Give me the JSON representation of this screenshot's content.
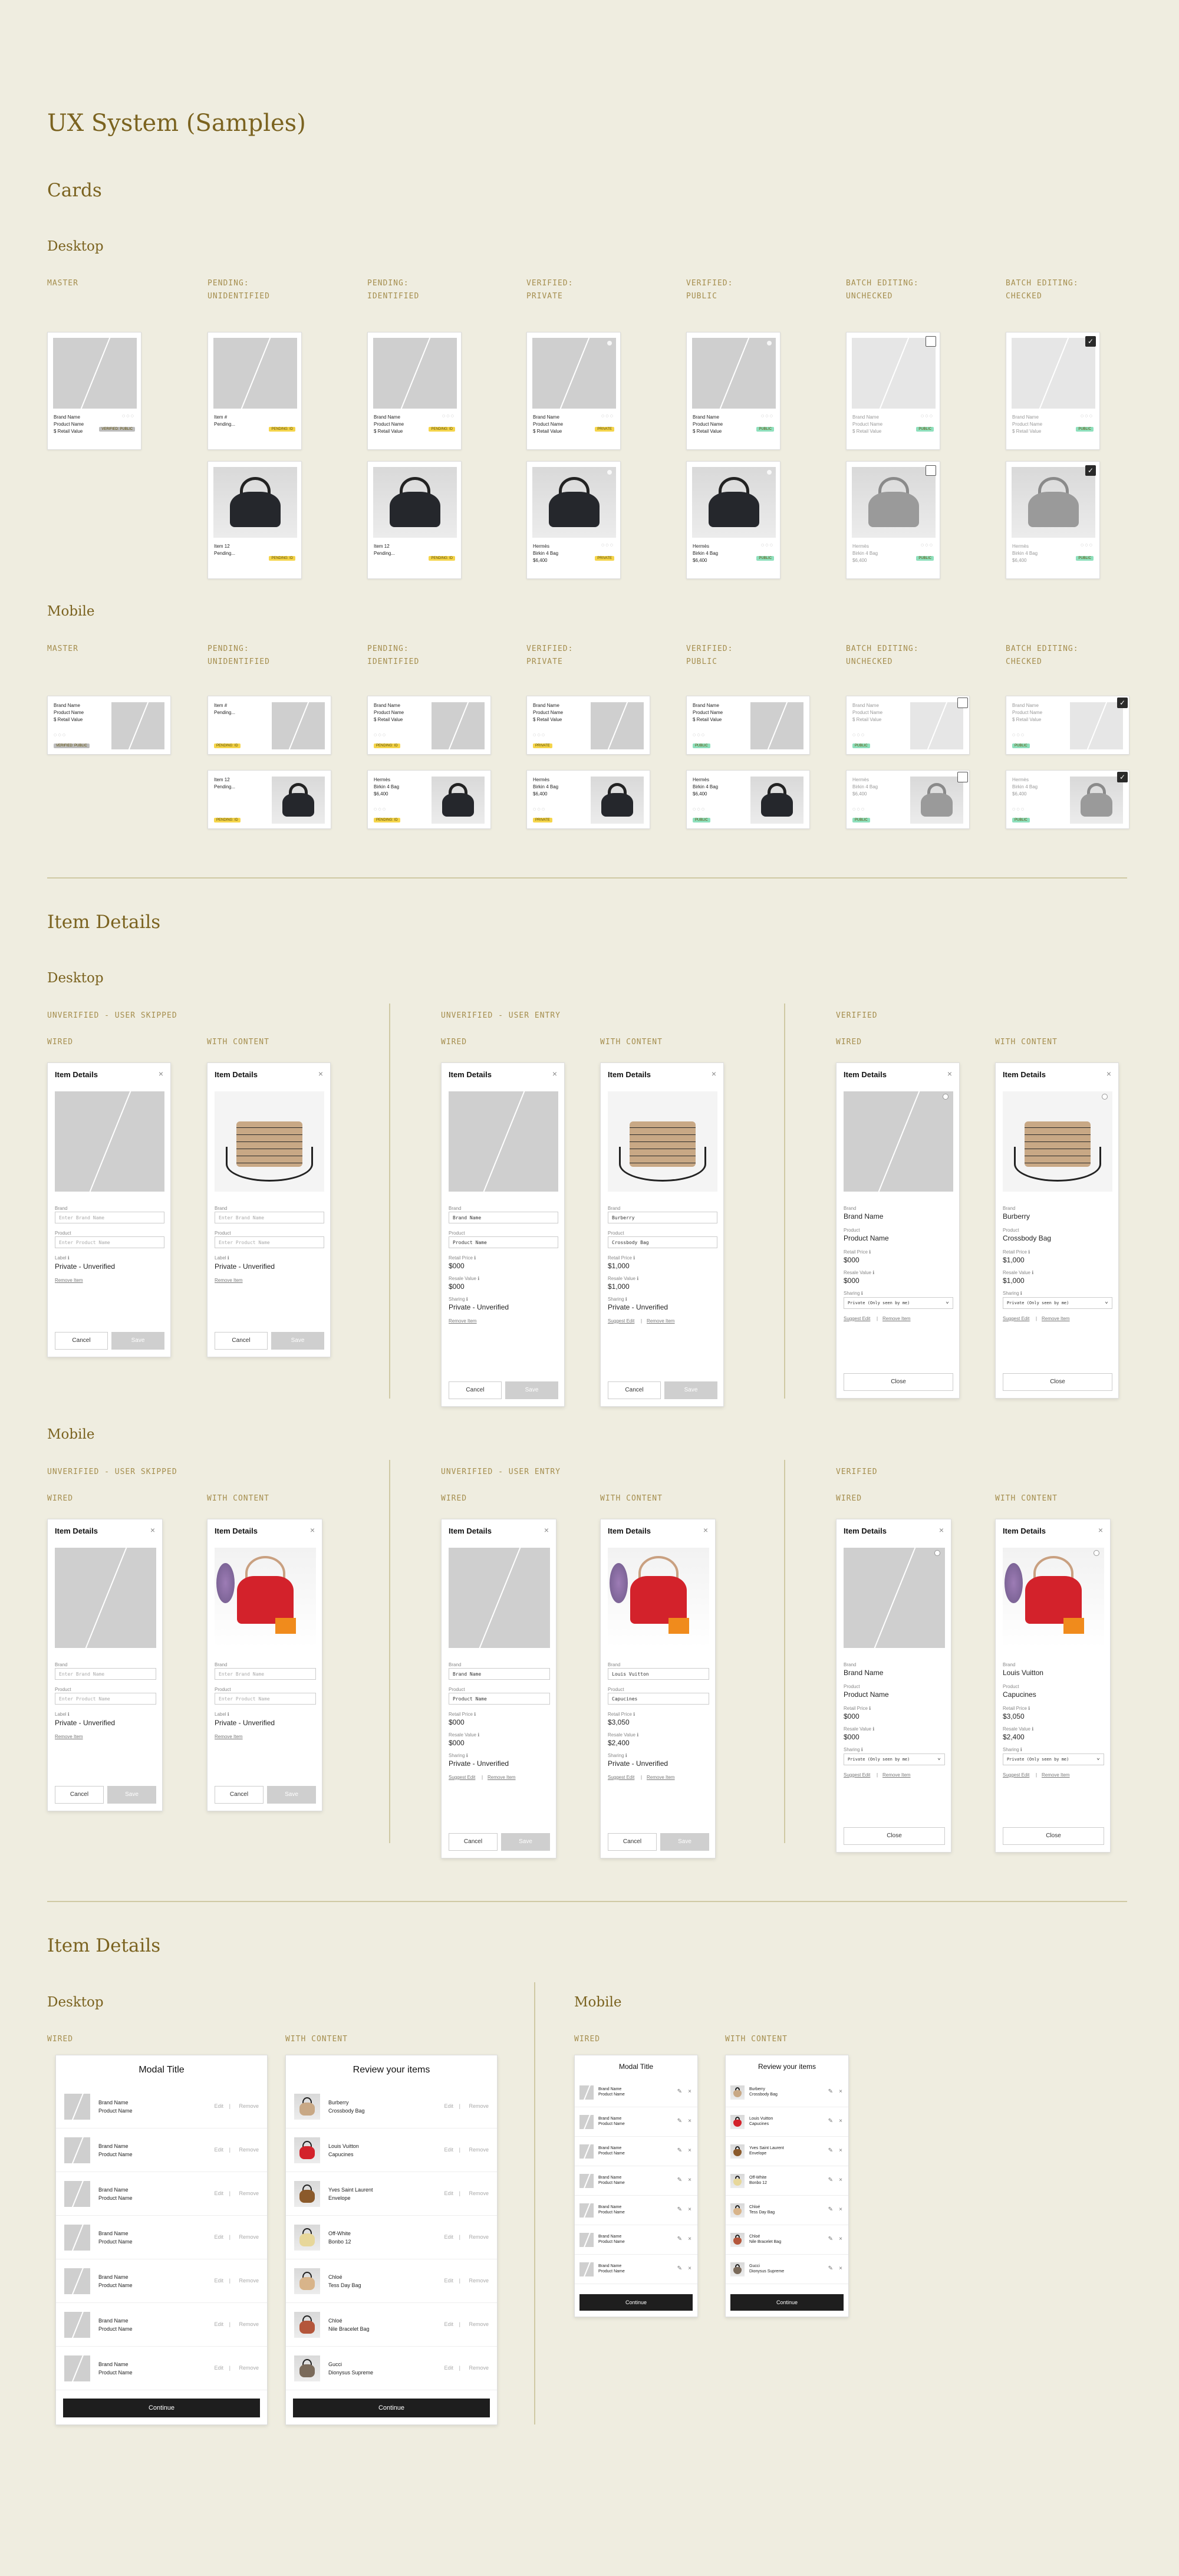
{
  "title": "UX System (Samples)",
  "cards": {
    "heading": "Cards",
    "desktop_heading": "Desktop",
    "mobile_heading": "Mobile",
    "columns": [
      "MASTER",
      "PENDING:\nUNIDENTIFIED",
      "PENDING:\nIDENTIFIED",
      "VERIFIED:\nPRIVATE",
      "VERIFIED:\nPUBLIC",
      "BATCH EDITING:\nUNCHECKED",
      "BATCH EDITING:\nCHECKED"
    ],
    "wired": {
      "brand": "Brand Name",
      "product": "Product Name",
      "retail": "$ Retail Value",
      "pending_item": "Item #",
      "pending": "Pending..."
    },
    "bag": {
      "item": "Item 12",
      "brand": "Hermès",
      "product": "Birkin 4 Bag",
      "price": "$6,400"
    },
    "tags": {
      "master": "VERIFIED: PUBLIC",
      "pending": "PENDING: ID",
      "private": "PRIVATE",
      "public": "PUBLIC"
    },
    "check_glyph": "✓"
  },
  "item_details": {
    "heading": "Item Details",
    "desktop_heading": "Desktop",
    "mobile_heading": "Mobile",
    "groups": [
      "UNVERIFIED - USER SKIPPED",
      "UNVERIFIED - USER ENTRY",
      "VERIFIED"
    ],
    "variants": [
      "WIRED",
      "WITH CONTENT"
    ],
    "dialog_title": "Item Details",
    "close_glyph": "×",
    "labels": {
      "brand": "Brand",
      "product": "Product",
      "label": "Label ℹ",
      "retail": "Retail Price ℹ",
      "resale": "Resale Value ℹ",
      "sharing": "Sharing ℹ"
    },
    "placeholders": {
      "brand": "Enter Brand Name",
      "product": "Enter Product Name"
    },
    "wired_values": {
      "brand": "Brand Name",
      "product": "Product Name",
      "retail": "$000",
      "resale": "$000"
    },
    "desktop_content": {
      "brand": "Burberry",
      "product": "Crossbody Bag",
      "retail": "$1,000",
      "resale": "$1,000"
    },
    "mobile_content": {
      "brand": "Louis Vuitton",
      "product": "Capucines",
      "retail": "$3,050",
      "resale": "$2,400"
    },
    "private_unverified": "Private - Unverified",
    "sharing_select": "Private (Only seen by me)",
    "links": {
      "remove": "Remove Item",
      "suggest": "Suggest Edit",
      "separator": "|"
    },
    "buttons": {
      "cancel": "Cancel",
      "save": "Save",
      "close": "Close"
    }
  },
  "review": {
    "heading": "Item Details",
    "desktop_heading": "Desktop",
    "mobile_heading": "Mobile",
    "variants": [
      "WIRED",
      "WITH CONTENT"
    ],
    "modal_title": "Modal Title",
    "review_title": "Review your items",
    "wired_item": {
      "brand": "Brand Name",
      "product": "Product Name"
    },
    "items": [
      {
        "brand": "Burberry",
        "product": "Crossbody Bag"
      },
      {
        "brand": "Louis Vuitton",
        "product": "Capucines"
      },
      {
        "brand": "Yves Saint Laurent",
        "product": "Envelope"
      },
      {
        "brand": "Off-White",
        "product": "Bonbo 12"
      },
      {
        "brand": "Chloé",
        "product": "Tess Day Bag"
      },
      {
        "brand": "Chloé",
        "product": "Nile Bracelet Bag"
      },
      {
        "brand": "Gucci",
        "product": "Dionysus Supreme"
      }
    ],
    "actions": {
      "edit": "Edit",
      "remove": "Remove",
      "sep": "|",
      "edit_glyph": "✎",
      "remove_glyph": "×"
    },
    "continue": "Continue"
  }
}
